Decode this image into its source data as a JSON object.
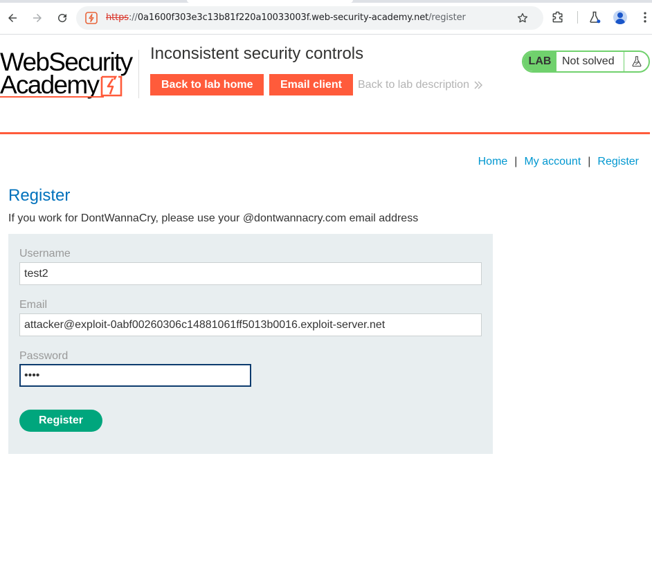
{
  "browser": {
    "url_scheme": "https",
    "url_sep": "://",
    "url_host": "0a1600f303e3c13b81f220a10033003f.web-security-academy.net",
    "url_path": "/register"
  },
  "header": {
    "logo_line1": "WebSecurity",
    "logo_line2": "Academy",
    "lab_title": "Inconsistent security controls",
    "back_home_label": "Back to lab home",
    "email_client_label": "Email client",
    "back_desc_label": "Back to lab description",
    "lab_badge": "LAB",
    "lab_state": "Not solved"
  },
  "nav": {
    "home": "Home",
    "sep1": "|",
    "my_account": "My account",
    "sep2": "|",
    "register": "Register"
  },
  "page": {
    "title": "Register",
    "intro": "If you work for DontWannaCry, please use your @dontwannacry.com email address"
  },
  "form": {
    "username_label": "Username",
    "username_value": "test2",
    "email_label": "Email",
    "email_value": "attacker@exploit-0abf00260306c14881061ff5013b0016.exploit-server.net",
    "password_label": "Password",
    "password_value": "••••",
    "submit_label": "Register"
  },
  "colors": {
    "brand_orange": "#ff5b3b",
    "link_blue": "#0097d0",
    "heading_blue": "#0071bc",
    "lab_green": "#70d16d",
    "submit_green": "#00a67d"
  }
}
